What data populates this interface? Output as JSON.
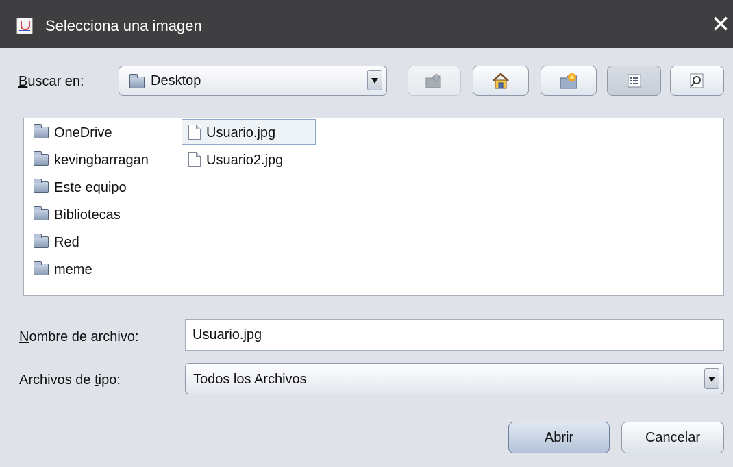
{
  "window": {
    "title": "Selecciona una imagen",
    "close_glyph": "✕"
  },
  "lookin": {
    "label_key": "B",
    "label_rest": "uscar en:",
    "value": "Desktop"
  },
  "toolbar": {
    "icons": [
      "up-folder-icon",
      "home-icon",
      "new-folder-icon",
      "list-view-icon",
      "details-view-icon"
    ]
  },
  "files": {
    "folders": [
      "OneDrive",
      "kevingbarragan",
      "Este equipo",
      "Bibliotecas",
      "Red",
      "meme"
    ],
    "items": [
      "Usuario.jpg",
      "Usuario2.jpg"
    ],
    "selected": "Usuario.jpg"
  },
  "filename": {
    "label_key": "N",
    "label_rest": "ombre de archivo:",
    "value": "Usuario.jpg"
  },
  "filetype": {
    "label_before": "Archivos de ",
    "label_key": "t",
    "label_after": "ipo:",
    "value": "Todos los Archivos"
  },
  "buttons": {
    "open": "Abrir",
    "cancel": "Cancelar"
  },
  "colors": {
    "titlebar": "#3f3f41",
    "dialog_bg": "#dfe2e8",
    "selection_border": "#8aa7c9"
  }
}
